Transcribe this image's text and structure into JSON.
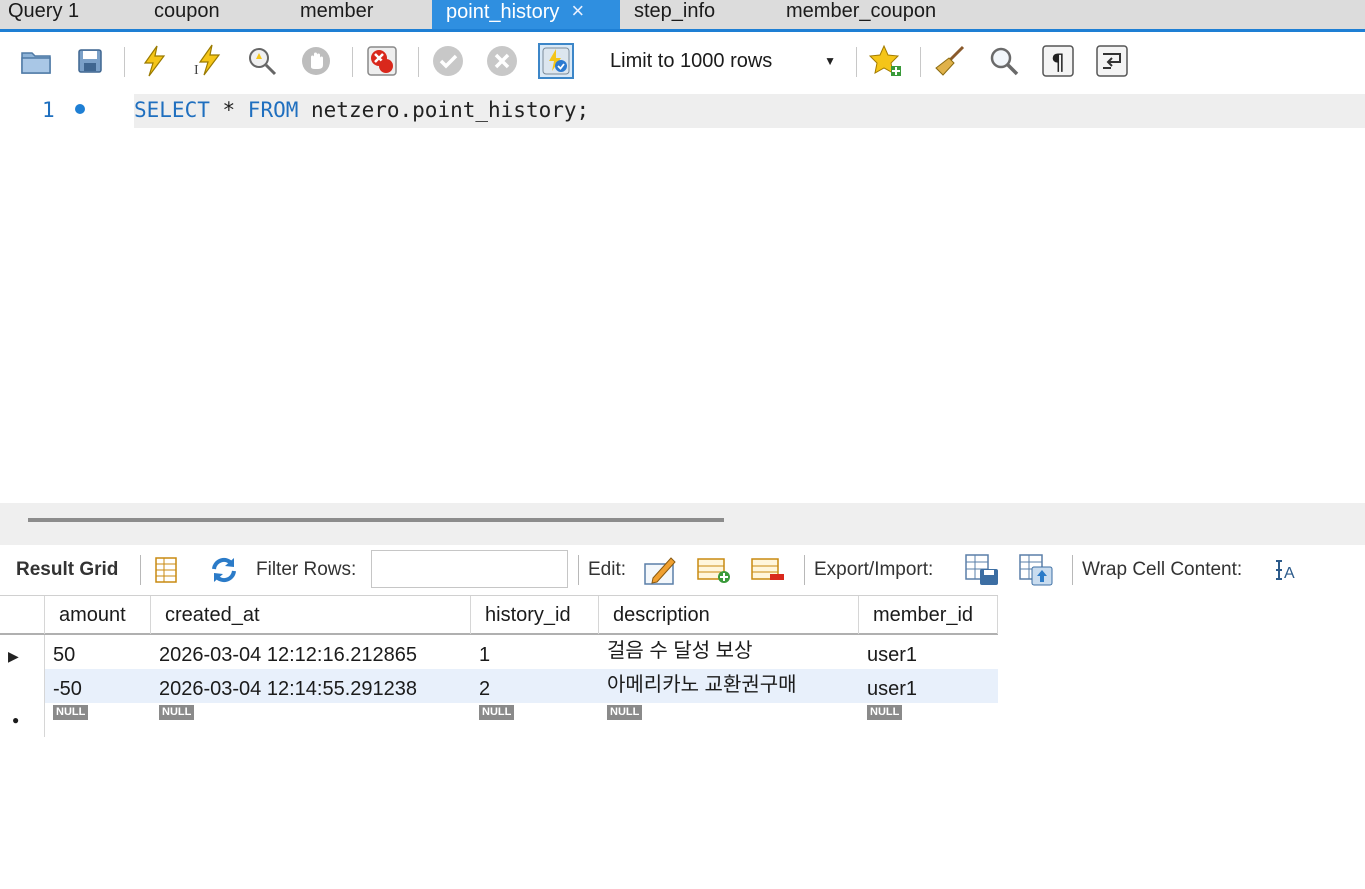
{
  "tabs": [
    {
      "label": "Query 1",
      "active": false
    },
    {
      "label": "coupon",
      "active": false
    },
    {
      "label": "member",
      "active": false
    },
    {
      "label": "point_history",
      "active": true,
      "close": "×"
    },
    {
      "label": "step_info",
      "active": false
    },
    {
      "label": "member_coupon",
      "active": false
    }
  ],
  "toolbar": {
    "icons": [
      "open-folder-icon",
      "save-icon",
      "execute-icon",
      "execute-current-icon",
      "explain-icon",
      "stop-icon",
      "toggle-error-icon",
      "commit-icon",
      "rollback-icon",
      "autocommit-icon",
      "add-snippet-icon",
      "beautify-icon",
      "find-icon",
      "invisible-chars-icon",
      "wrap-icon"
    ],
    "limit_label": "Limit to 1000 rows"
  },
  "editor": {
    "line_number": "1",
    "code_parts": {
      "kw1": "SELECT",
      "op": " * ",
      "kw2": "FROM",
      "rest": " netzero.point_history;"
    }
  },
  "result_toolbar": {
    "result_grid": "Result Grid",
    "filter_rows": "Filter Rows:",
    "filter_value": "",
    "edit": "Edit:",
    "export_import": "Export/Import:",
    "wrap_cell": "Wrap Cell Content:"
  },
  "grid": {
    "columns": [
      "amount",
      "created_at",
      "history_id",
      "description",
      "member_id"
    ],
    "rows": [
      [
        "50",
        "2026-03-04 12:12:16.212865",
        "1",
        "걸음 수 달성 보상",
        "user1"
      ],
      [
        "-50",
        "2026-03-04 12:14:55.291238",
        "2",
        "아메리카노 교환권구매",
        "user1"
      ]
    ],
    "null_label": "NULL",
    "current_row_marker": "▶",
    "new_row_marker": "●"
  },
  "colors": {
    "accent": "#2f8fe0",
    "keyword": "#1f6fbf",
    "alt_row": "#e8f0fb"
  }
}
